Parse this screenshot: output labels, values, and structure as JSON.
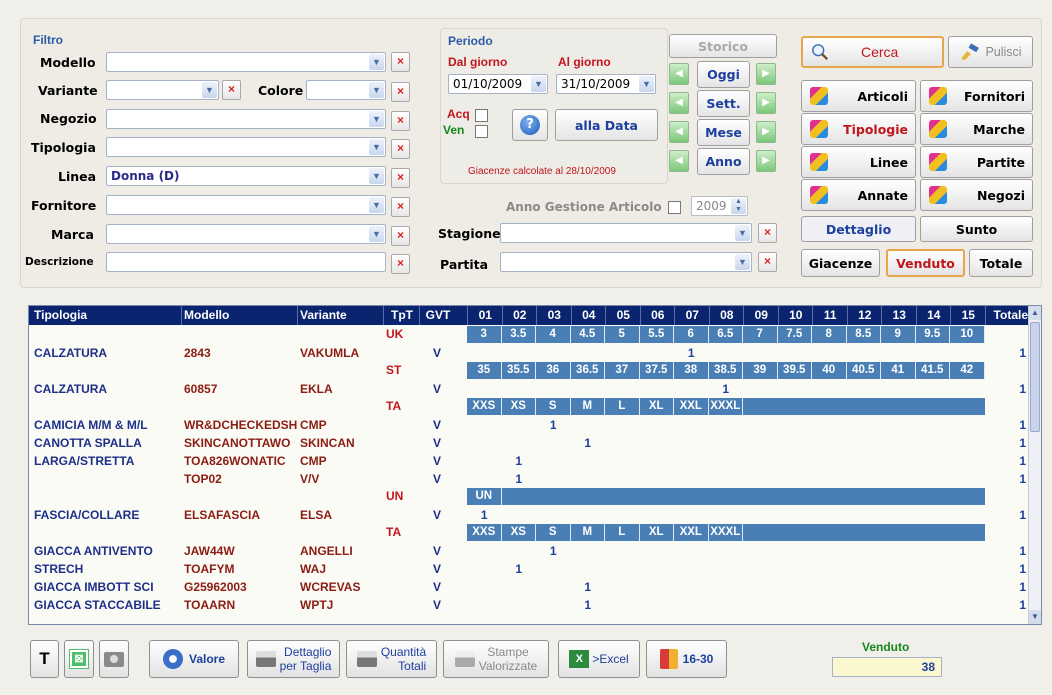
{
  "filtro": {
    "title": "Filtro",
    "modello_label": "Modello",
    "variante_label": "Variante",
    "colore_label": "Colore",
    "negozio_label": "Negozio",
    "tipologia_label": "Tipologia",
    "linea_label": "Linea",
    "linea_value": "Donna  (D)",
    "fornitore_label": "Fornitore",
    "marca_label": "Marca",
    "descrizione_label": "Descrizione"
  },
  "periodo": {
    "title": "Periodo",
    "dal_label": "Dal giorno",
    "al_label": "Al giorno",
    "dal_value": "01/10/2009",
    "al_value": "31/10/2009",
    "acq_label": "Acq",
    "ven_label": "Ven",
    "alla_data": "alla Data",
    "storico": "Storico",
    "oggi": "Oggi",
    "sett": "Sett.",
    "mese": "Mese",
    "anno": "Anno",
    "giacenze_note": "Giacenze calcolate al 28/10/2009"
  },
  "anno_gestione": {
    "label": "Anno Gestione Articolo",
    "value": "2009"
  },
  "stagione_label": "Stagione",
  "partita_label": "Partita",
  "actions": {
    "cerca": "Cerca",
    "pulisci": "Pulisci",
    "articoli": "Articoli",
    "fornitori": "Fornitori",
    "tipologie": "Tipologie",
    "marche": "Marche",
    "linee": "Linee",
    "partite": "Partite",
    "annate": "Annate",
    "negozi": "Negozi",
    "dettaglio": "Dettaglio",
    "sunto": "Sunto",
    "giacenze": "Giacenze",
    "venduto": "Venduto",
    "totale": "Totale"
  },
  "table": {
    "headers": [
      "Tipologia",
      "Modello",
      "Variante",
      "TpT",
      "GVT",
      "01",
      "02",
      "03",
      "04",
      "05",
      "06",
      "07",
      "08",
      "09",
      "10",
      "11",
      "12",
      "13",
      "14",
      "15",
      "Totale"
    ],
    "size_rows": [
      {
        "tpt": "UK",
        "sizes": [
          "3",
          "3.5",
          "4",
          "4.5",
          "5",
          "5.5",
          "6",
          "6.5",
          "7",
          "7.5",
          "8",
          "8.5",
          "9",
          "9.5",
          "10"
        ]
      },
      {
        "tpt": "ST",
        "sizes": [
          "35",
          "35.5",
          "36",
          "36.5",
          "37",
          "37.5",
          "38",
          "38.5",
          "39",
          "39.5",
          "40",
          "40.5",
          "41",
          "41.5",
          "42"
        ]
      },
      {
        "tpt": "TA",
        "sizes": [
          "XXS",
          "XS",
          "S",
          "M",
          "L",
          "XL",
          "XXL",
          "XXXL"
        ]
      },
      {
        "tpt": "UN",
        "sizes": [
          "UN"
        ]
      },
      {
        "tpt": "TA",
        "sizes": [
          "XXS",
          "XS",
          "S",
          "M",
          "L",
          "XL",
          "XXL",
          "XXXL"
        ]
      }
    ],
    "rows": [
      {
        "tip": "CALZATURA",
        "mod": "2843",
        "var": "VAKUMLA",
        "gvt": "V",
        "qty": "1",
        "col": 7,
        "tot": "1"
      },
      {
        "tip": "CALZATURA",
        "mod": "60857",
        "var": "EKLA",
        "gvt": "V",
        "qty": "1",
        "col": 8,
        "tot": "1"
      },
      {
        "tip": "CAMICIA M/M & M/L",
        "mod": "WR&DCHECKEDSH",
        "var": "CMP",
        "gvt": "V",
        "qty": "1",
        "col": 3,
        "tot": "1"
      },
      {
        "tip": "CANOTTA SPALLA",
        "mod": "SKINCANOTTAWO",
        "var": "SKINCAN",
        "gvt": "V",
        "qty": "1",
        "col": 4,
        "tot": "1"
      },
      {
        "tip": "LARGA/STRETTA",
        "mod": "TOA826WONATIC",
        "var": "CMP",
        "gvt": "V",
        "qty": "1",
        "col": 2,
        "tot": "1"
      },
      {
        "tip": "",
        "mod": "TOP02",
        "var": "V/V",
        "gvt": "V",
        "qty": "1",
        "col": 2,
        "tot": "1"
      },
      {
        "tip": "FASCIA/COLLARE",
        "mod": "ELSAFASCIA",
        "var": "ELSA",
        "gvt": "V",
        "qty": "1",
        "col": 1,
        "tot": "1"
      },
      {
        "tip": "GIACCA ANTIVENTO",
        "mod": "JAW44W",
        "var": "ANGELLI",
        "gvt": "V",
        "qty": "1",
        "col": 3,
        "tot": "1"
      },
      {
        "tip": "STRECH",
        "mod": "TOAFYM",
        "var": "WAJ",
        "gvt": "V",
        "qty": "1",
        "col": 2,
        "tot": "1"
      },
      {
        "tip": "GIACCA IMBOTT SCI",
        "mod": "G25962003",
        "var": "WCREVAS",
        "gvt": "V",
        "qty": "1",
        "col": 4,
        "tot": "1"
      },
      {
        "tip": "GIACCA STACCABILE",
        "mod": "TOAARN",
        "var": "WPTJ",
        "gvt": "V",
        "qty": "1",
        "col": 4,
        "tot": "1"
      }
    ]
  },
  "bottom": {
    "t": "T",
    "valore": "Valore",
    "dettaglio1": "Dettaglio",
    "dettaglio2": "per Taglia",
    "quantita1": "Quantità",
    "quantita2": "Totali",
    "stampe1": "Stampe",
    "stampe2": "Valorizzate",
    "excel": ">Excel",
    "range": "16-30",
    "venduto_label": "Venduto",
    "venduto_value": "38"
  }
}
